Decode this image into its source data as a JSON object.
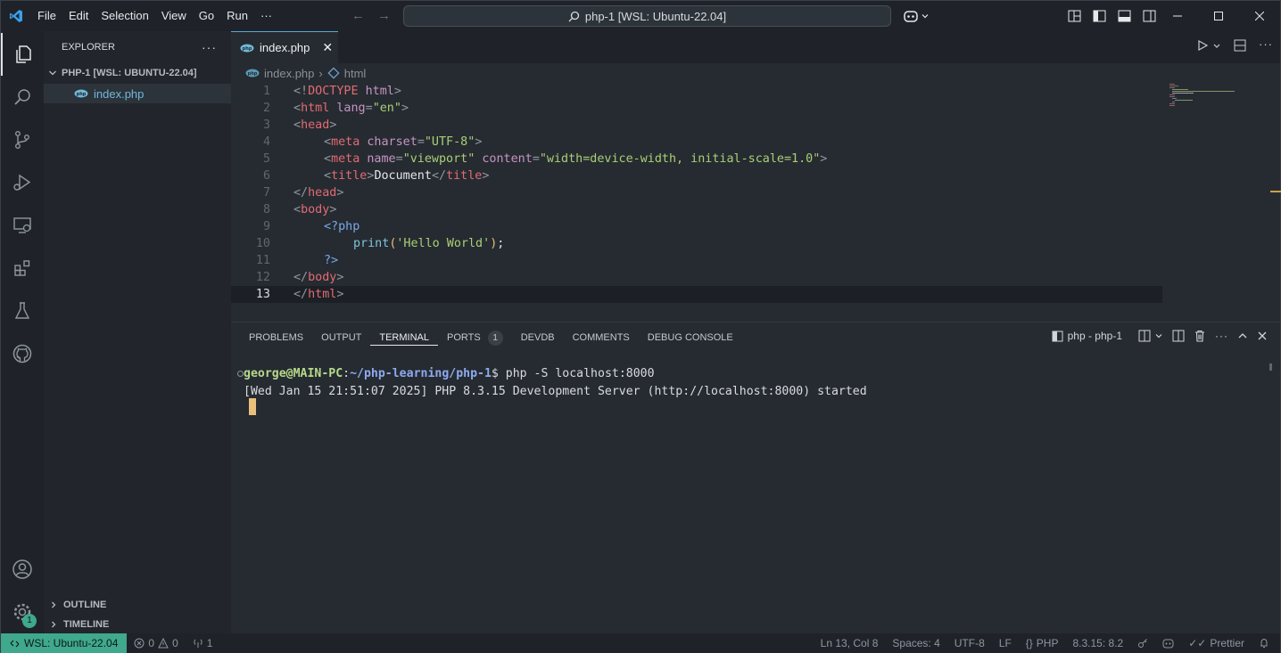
{
  "menu": [
    "File",
    "Edit",
    "Selection",
    "View",
    "Go",
    "Run",
    "···"
  ],
  "command_center": "php-1 [WSL: Ubuntu-22.04]",
  "sidebar": {
    "title": "EXPLORER",
    "folder": "PHP-1 [WSL: UBUNTU-22.04]",
    "file": "index.php",
    "outline": "OUTLINE",
    "timeline": "TIMELINE"
  },
  "editor": {
    "tab": "index.php",
    "breadcrumb": {
      "file": "index.php",
      "symbol": "html"
    },
    "lines": [
      {
        "n": "1"
      },
      {
        "n": "2"
      },
      {
        "n": "3"
      },
      {
        "n": "4"
      },
      {
        "n": "5"
      },
      {
        "n": "6"
      },
      {
        "n": "7"
      },
      {
        "n": "8"
      },
      {
        "n": "9"
      },
      {
        "n": "10"
      },
      {
        "n": "11"
      },
      {
        "n": "12"
      },
      {
        "n": "13"
      }
    ],
    "code": {
      "l1": {
        "a": "<!",
        "b": "DOCTYPE",
        "c": " html",
        "d": ">"
      },
      "l2": {
        "a": "<",
        "b": "html",
        "c": " lang",
        "d": "=",
        "e": "\"en\"",
        "f": ">"
      },
      "l3": {
        "a": "<",
        "b": "head",
        "c": ">"
      },
      "l4": {
        "a": "<",
        "b": "meta",
        "c": " charset",
        "d": "=",
        "e": "\"UTF-8\"",
        "f": ">"
      },
      "l5": {
        "a": "<",
        "b": "meta",
        "c": " name",
        "d": "=",
        "e": "\"viewport\"",
        "g": " content",
        "h": "=",
        "i": "\"width=device-width, initial-scale=1.0\"",
        "j": ">"
      },
      "l6": {
        "a": "<",
        "b": "title",
        "c": ">",
        "d": "Document",
        "e": "</",
        "f": "title",
        "g": ">"
      },
      "l7": {
        "a": "</",
        "b": "head",
        "c": ">"
      },
      "l8": {
        "a": "<",
        "b": "body",
        "c": ">"
      },
      "l9": {
        "a": "<?php"
      },
      "l10": {
        "a": "print",
        "b": "(",
        "c": "'Hello World'",
        "d": ")",
        "e": ";"
      },
      "l11": {
        "a": "?>"
      },
      "l12": {
        "a": "</",
        "b": "body",
        "c": ">"
      },
      "l13": {
        "a": "</",
        "b": "html",
        "c": ">"
      }
    }
  },
  "panel": {
    "tabs": [
      "PROBLEMS",
      "OUTPUT",
      "TERMINAL",
      "PORTS",
      "DEVDB",
      "COMMENTS",
      "DEBUG CONSOLE"
    ],
    "ports_badge": "1",
    "terminal_name": "php - php-1",
    "terminal": {
      "user": "george@MAIN-PC",
      "colon": ":",
      "path": "~/php-learning/php-1",
      "prompt": "$ php -S localhost:8000",
      "output": "[Wed Jan 15 21:51:07 2025] PHP 8.3.15 Development Server (http://localhost:8000) started"
    }
  },
  "status": {
    "remote": "WSL: Ubuntu-22.04",
    "errors": "0",
    "warnings": "0",
    "ports": "1",
    "position": "Ln 13, Col 8",
    "spaces": "Spaces: 4",
    "encoding": "UTF-8",
    "eol": "LF",
    "language": "PHP",
    "php_version": "8.3.15: 8.2",
    "prettier": "Prettier",
    "settings_badge": "1"
  },
  "colors": {
    "accent": "#57a9d3",
    "remote": "#3fa88d",
    "cursor": "#e8c07b"
  }
}
